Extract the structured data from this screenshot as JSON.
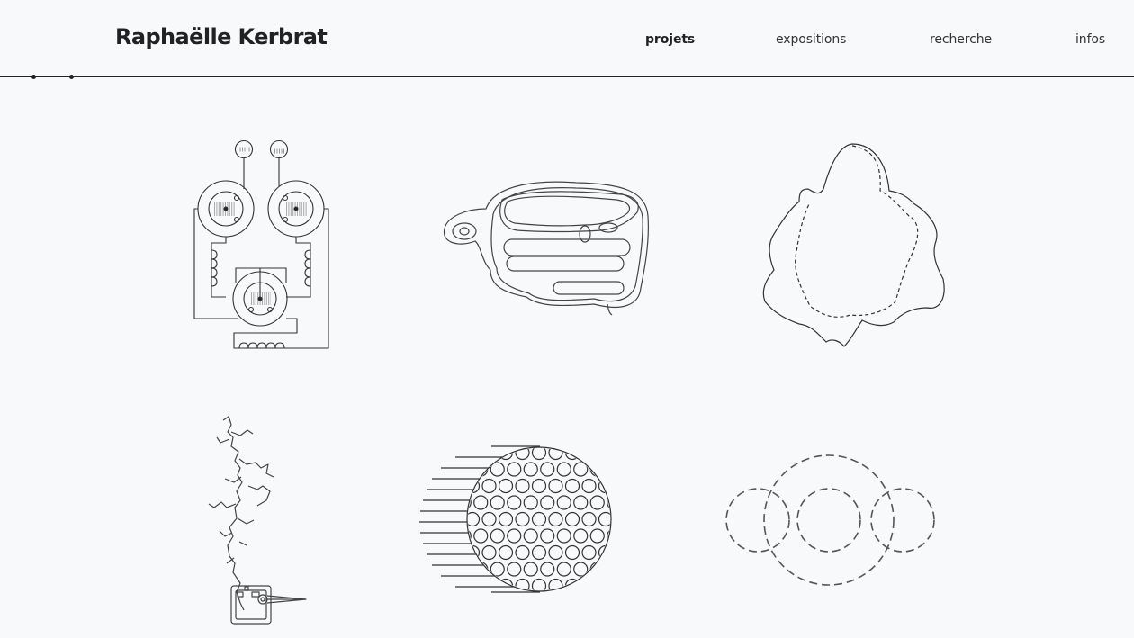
{
  "site": {
    "title": "Raphaëlle Kerbrat"
  },
  "nav": {
    "items": [
      {
        "label": "projets",
        "active": true
      },
      {
        "label": "expositions",
        "active": false
      },
      {
        "label": "recherche",
        "active": false
      },
      {
        "label": "infos",
        "active": false
      }
    ]
  },
  "projects": {
    "items": [
      {
        "icon": "circuit-drawing-icon"
      },
      {
        "icon": "contour-blob-icon"
      },
      {
        "icon": "leaf-outline-icon"
      },
      {
        "icon": "branching-root-icon"
      },
      {
        "icon": "perforated-disc-icon"
      },
      {
        "icon": "dashed-circles-icon"
      }
    ]
  },
  "colors": {
    "background": "#f7f9fb",
    "ink": "#222222"
  }
}
